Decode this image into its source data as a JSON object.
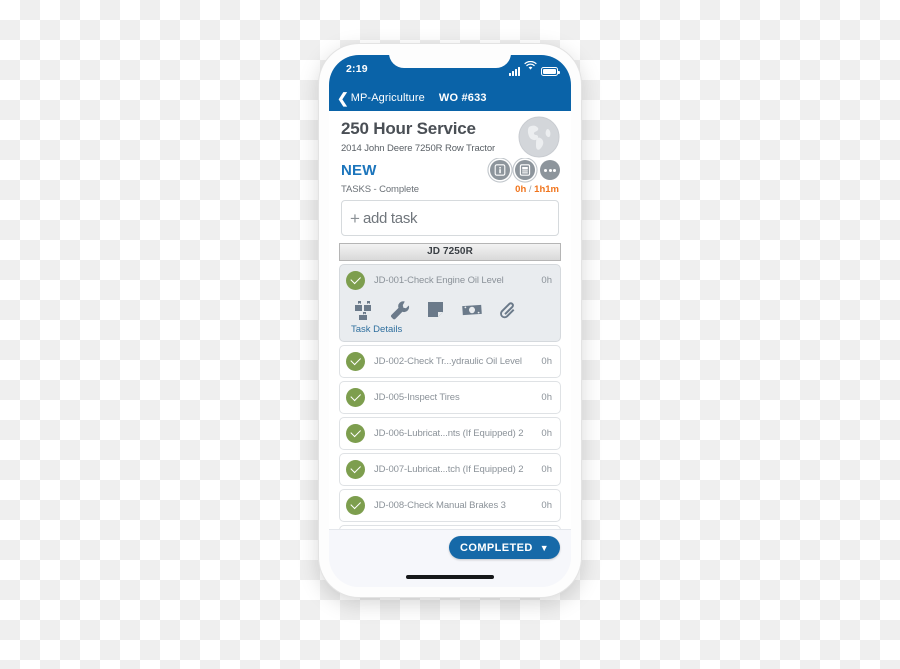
{
  "status_bar": {
    "time": "2:19",
    "signal_icon": "cellular-signal-icon",
    "wifi_icon": "wifi-icon",
    "battery_icon": "battery-icon"
  },
  "nav_bar": {
    "back_icon": "chevron-left-icon",
    "org_label": "MP-Agriculture",
    "work_order_label": "WO #633"
  },
  "work_order": {
    "title": "250 Hour Service",
    "asset": "2014 John Deere 7250R Row Tractor",
    "globe_icon": "globe-icon",
    "status": "NEW",
    "status_color": "#1c75bc",
    "actions": [
      {
        "name": "info-icon",
        "glyph": "i"
      },
      {
        "name": "document-icon",
        "glyph": "☰"
      },
      {
        "name": "more-options-icon",
        "glyph": "•••"
      }
    ]
  },
  "tasks_summary": {
    "label": "TASKS - Complete",
    "completed_hours": "0h",
    "separator": "/",
    "total_hours": "1h1m",
    "time_color": "#f0741c"
  },
  "add_task": {
    "plus_icon": "plus-icon",
    "plus_glyph": "+",
    "label": "add task",
    "placeholder": "add task"
  },
  "task_group": {
    "header": "JD 7250R",
    "tasks": [
      {
        "name": "JD-001-Check Engine Oil Level",
        "hours": "0h",
        "complete": true,
        "expanded": true
      },
      {
        "name": "JD-002-Check Tr...ydraulic Oil Level",
        "hours": "0h",
        "complete": true,
        "expanded": false
      },
      {
        "name": "JD-005-Inspect Tires",
        "hours": "0h",
        "complete": true,
        "expanded": false
      },
      {
        "name": "JD-006-Lubricat...nts (If Equipped) 2",
        "hours": "0h",
        "complete": true,
        "expanded": false
      },
      {
        "name": "JD-007-Lubricat...tch (If Equipped) 2",
        "hours": "0h",
        "complete": true,
        "expanded": false
      },
      {
        "name": "JD-008-Check Manual Brakes 3",
        "hours": "0h",
        "complete": true,
        "expanded": false
      }
    ]
  },
  "task_detail": {
    "icons": [
      {
        "name": "parts-icon"
      },
      {
        "name": "wrench-icon"
      },
      {
        "name": "note-icon"
      },
      {
        "name": "money-icon"
      },
      {
        "name": "paperclip-icon"
      }
    ],
    "details_link": "Task Details"
  },
  "bottom_bar": {
    "completed_label": "COMPLETED",
    "caret_glyph": "▼",
    "caret_icon": "chevron-down-icon",
    "button_color": "#1669a8"
  }
}
